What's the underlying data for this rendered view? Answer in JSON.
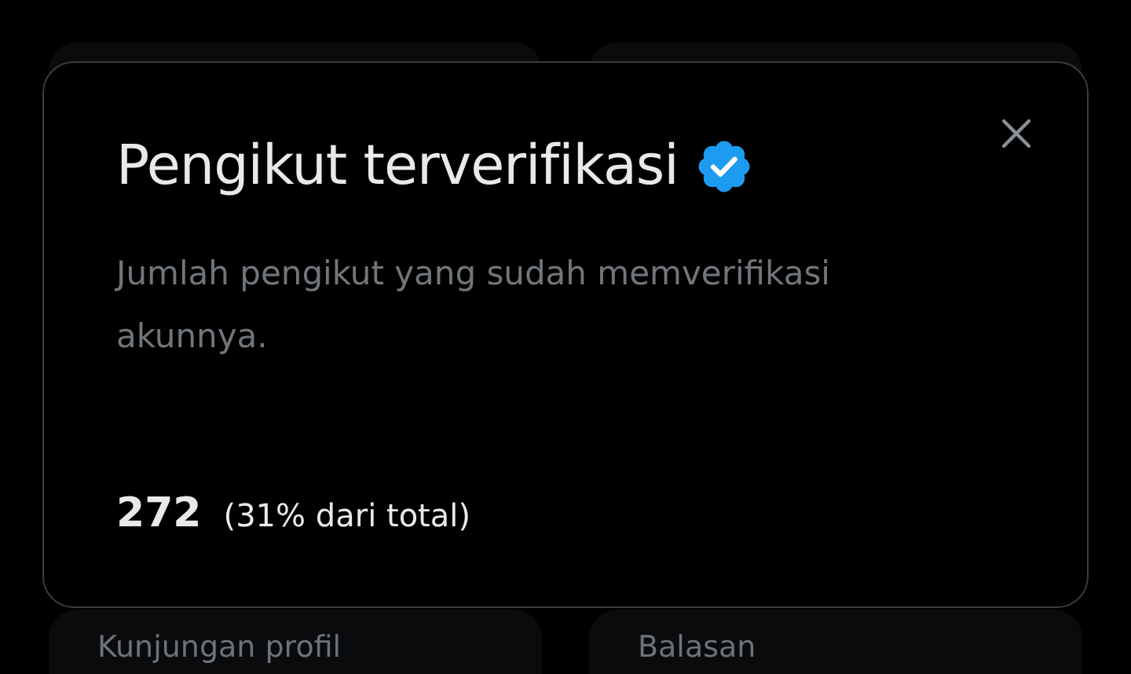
{
  "background_cards": [
    {
      "label": "Kunjungan profil"
    },
    {
      "label": "Balasan"
    }
  ],
  "dialog": {
    "title": "Pengikut terverifikasi",
    "verified": true,
    "description": "Jumlah pengikut yang sudah memverifikasi akunnya.",
    "count": "272",
    "share": "(31% dari total)"
  }
}
